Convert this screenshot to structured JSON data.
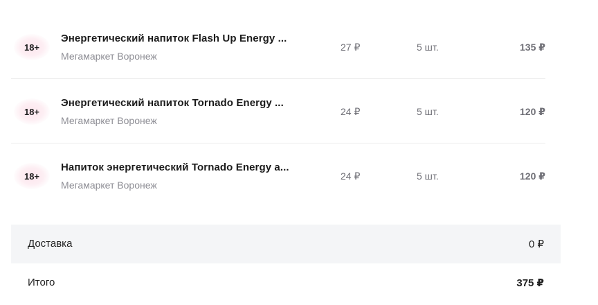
{
  "items": [
    {
      "age_badge": "18+",
      "title": "Энергетический напиток Flash Up Energy ...",
      "seller": "Мегамаркет Воронеж",
      "price": "27 ₽",
      "quantity": "5 шт.",
      "sum": "135 ₽"
    },
    {
      "age_badge": "18+",
      "title": "Энергетический напиток Tornado Energy ...",
      "seller": "Мегамаркет Воронеж",
      "price": "24 ₽",
      "quantity": "5 шт.",
      "sum": "120 ₽"
    },
    {
      "age_badge": "18+",
      "title": "Напиток энергетический Tornado Energy a...",
      "seller": "Мегамаркет Воронеж",
      "price": "24 ₽",
      "quantity": "5 шт.",
      "sum": "120 ₽"
    }
  ],
  "delivery": {
    "label": "Доставка",
    "value": "0 ₽"
  },
  "total": {
    "label": "Итого",
    "value": "375 ₽"
  },
  "colors": {
    "badge_glow": "#fde6ee",
    "summary_background": "#f4f5f7",
    "muted_text": "#8d8d94"
  }
}
